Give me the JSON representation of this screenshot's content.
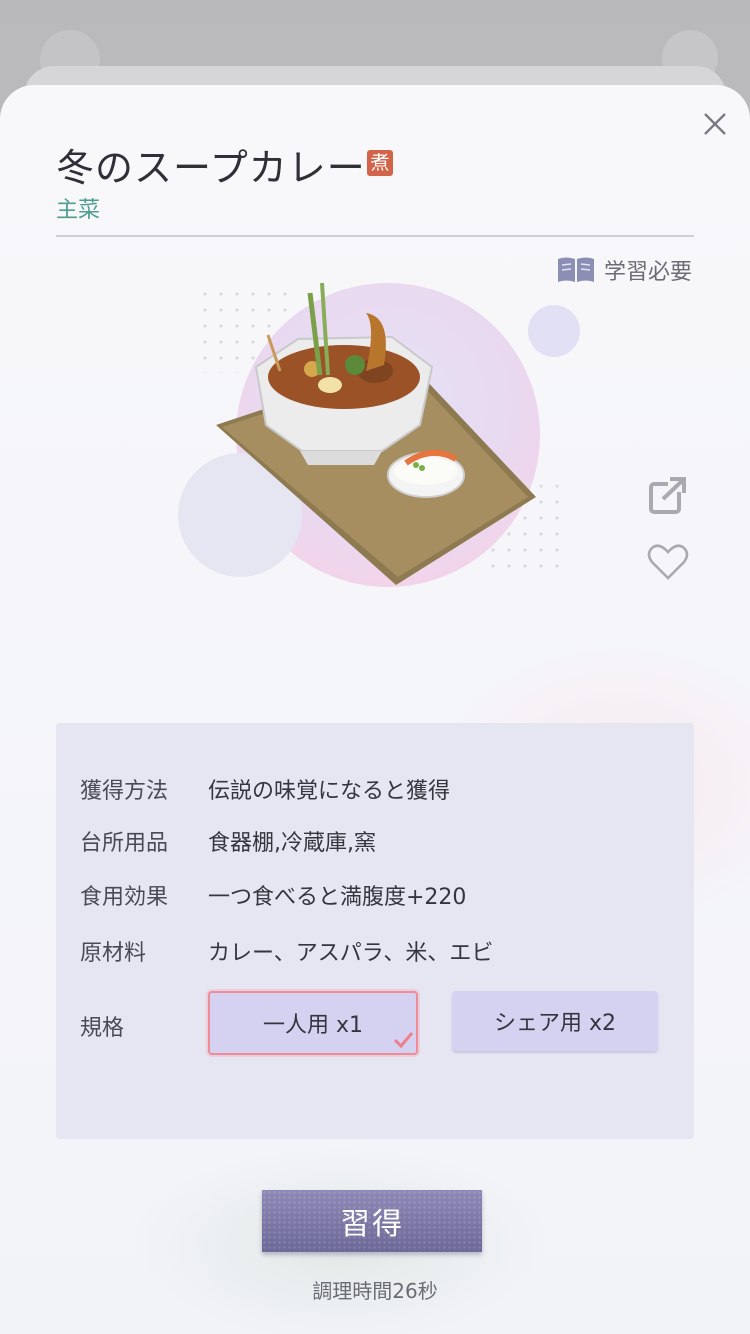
{
  "dish": {
    "title": "冬のスープカレー",
    "method_badge": "煮",
    "category": "主菜",
    "learn_required": "学習必要"
  },
  "info": {
    "rows": [
      {
        "label": "獲得方法",
        "value": "伝説の味覚になると獲得"
      },
      {
        "label": "台所用品",
        "value": "食器棚,冷蔵庫,窯"
      },
      {
        "label": "食用効果",
        "value": "一つ食べると満腹度+220"
      },
      {
        "label": "原材料",
        "value": "カレー、アスパラ、米、エビ"
      }
    ],
    "spec_label": "規格",
    "spec_options": [
      {
        "label": "一人用 x1",
        "selected": true
      },
      {
        "label": "シェア用 x2",
        "selected": false
      }
    ]
  },
  "action": {
    "learn_button": "習得",
    "cook_time": "調理時間26秒"
  },
  "colors": {
    "accent": "#7b77a8",
    "category": "#4e9e90",
    "badge": "#d2644a",
    "selected_border": "#ef8c98",
    "panel": "#e6e6f3"
  },
  "icons": [
    "close-icon",
    "book-icon",
    "share-icon",
    "heart-icon",
    "checkmark-icon"
  ]
}
